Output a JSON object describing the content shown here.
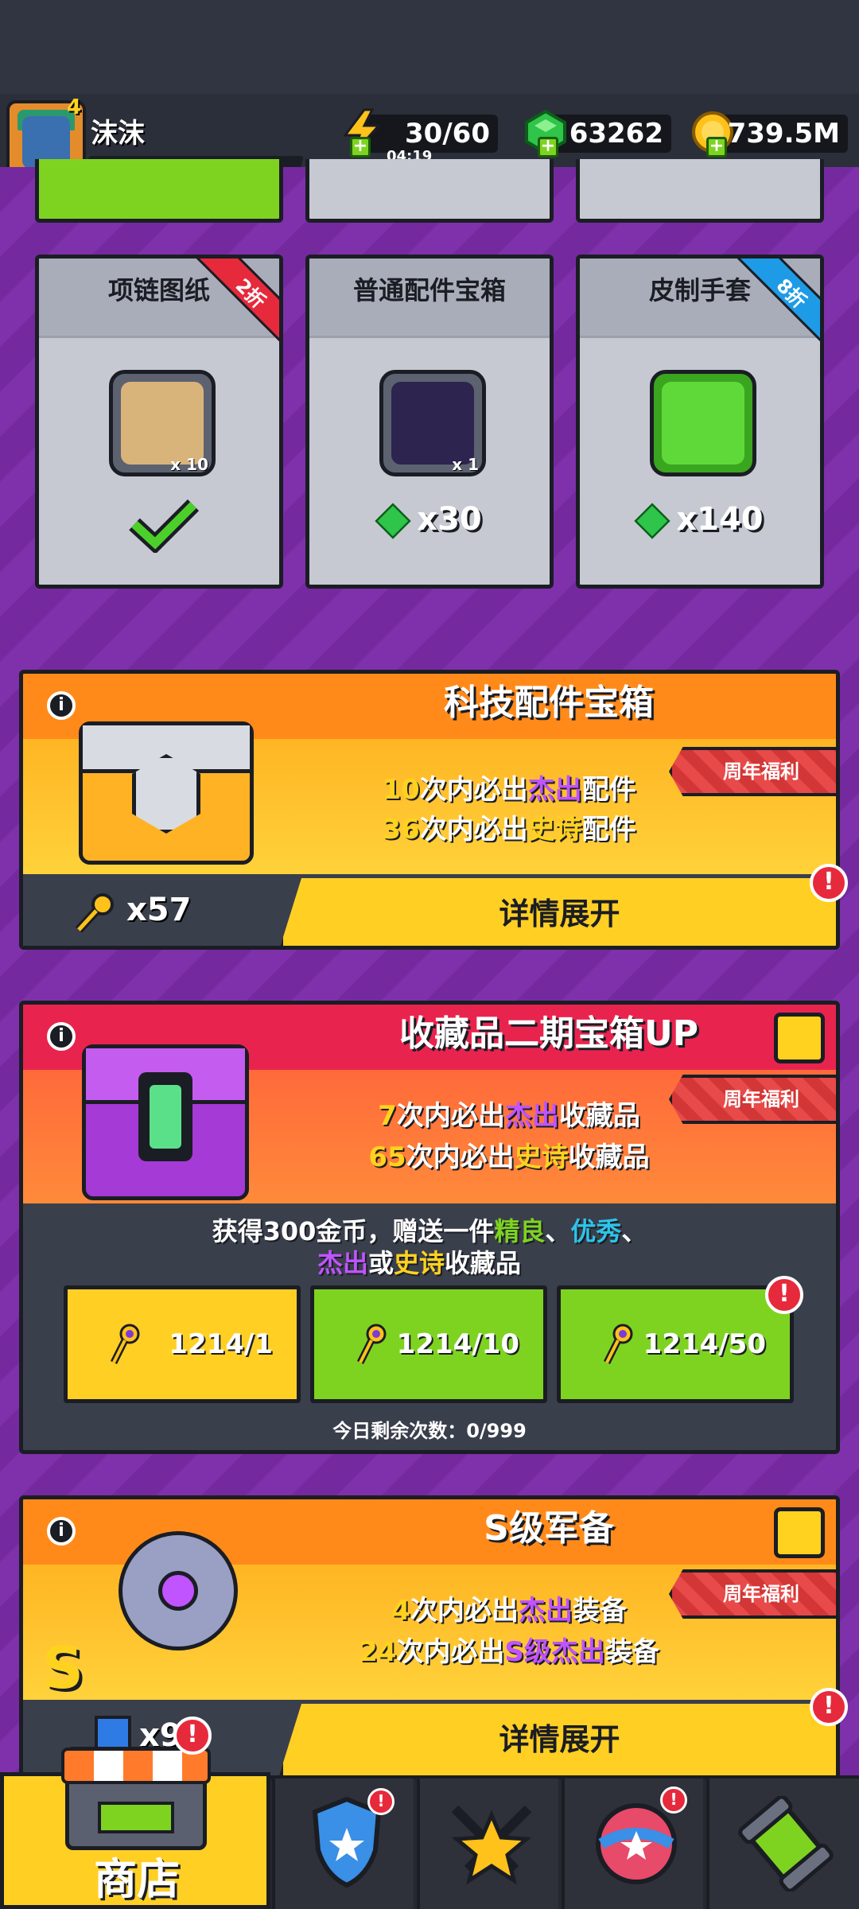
{
  "player": {
    "name": "沫沫",
    "level": "4",
    "xp": "124"
  },
  "resources": {
    "energy": "30/60",
    "energy_timer": "04:19",
    "gems": "63262",
    "gold": "739.5M"
  },
  "shop_cards": [
    {
      "title": "项链图纸",
      "qty": "x 10",
      "price": "",
      "purchased": true,
      "ribbon": "2折"
    },
    {
      "title": "普通配件宝箱",
      "qty": "x 1",
      "price": "x30",
      "purchased": false,
      "ribbon": ""
    },
    {
      "title": "皮制手套",
      "qty": "",
      "price": "x140",
      "purchased": false,
      "ribbon": "8折"
    }
  ],
  "chest1": {
    "title": "科技配件宝箱",
    "tag": "周年福利",
    "line1": {
      "num": "10",
      "pre": "次内必出",
      "rare": "杰出",
      "post": "配件"
    },
    "line2": {
      "num": "36",
      "pre": "次内必出",
      "rare": "史诗",
      "post": "配件"
    },
    "keys": "x57",
    "expand_label": "详情展开"
  },
  "chest2": {
    "title": "收藏品二期宝箱UP",
    "tag": "周年福利",
    "line1": {
      "num": "7",
      "pre": "次内必出",
      "rare": "杰出",
      "post": "收藏品"
    },
    "line2": {
      "num": "65",
      "pre": "次内必出",
      "rare": "史诗",
      "post": "收藏品"
    },
    "desc1": {
      "a": "获得300金币，赠送一件",
      "b": "精良",
      "c": "、",
      "d": "优秀",
      "e": "、"
    },
    "desc2": {
      "a": "杰出",
      "b": "或",
      "c": "史诗",
      "d": "收藏品"
    },
    "buttons": [
      "1214/1",
      "1214/10",
      "1214/50"
    ],
    "remaining": "今日剩余次数：0/999"
  },
  "chest3": {
    "title": "S级军备",
    "tag": "周年福利",
    "line1": {
      "num": "4",
      "pre": "次内必出",
      "rare": "杰出",
      "post": "装备"
    },
    "line2": {
      "num": "24",
      "pre": "次内必出",
      "rare": "S级杰出",
      "post": "装备"
    },
    "keys": "x9",
    "expand_label": "详情展开"
  },
  "nav": {
    "shop": "商店"
  },
  "colors": {
    "epic": "#ffd21f",
    "outstanding": "#c054ff",
    "fine": "#7ed321",
    "excellent": "#2ec4e8",
    "red": "#e62a3c"
  }
}
